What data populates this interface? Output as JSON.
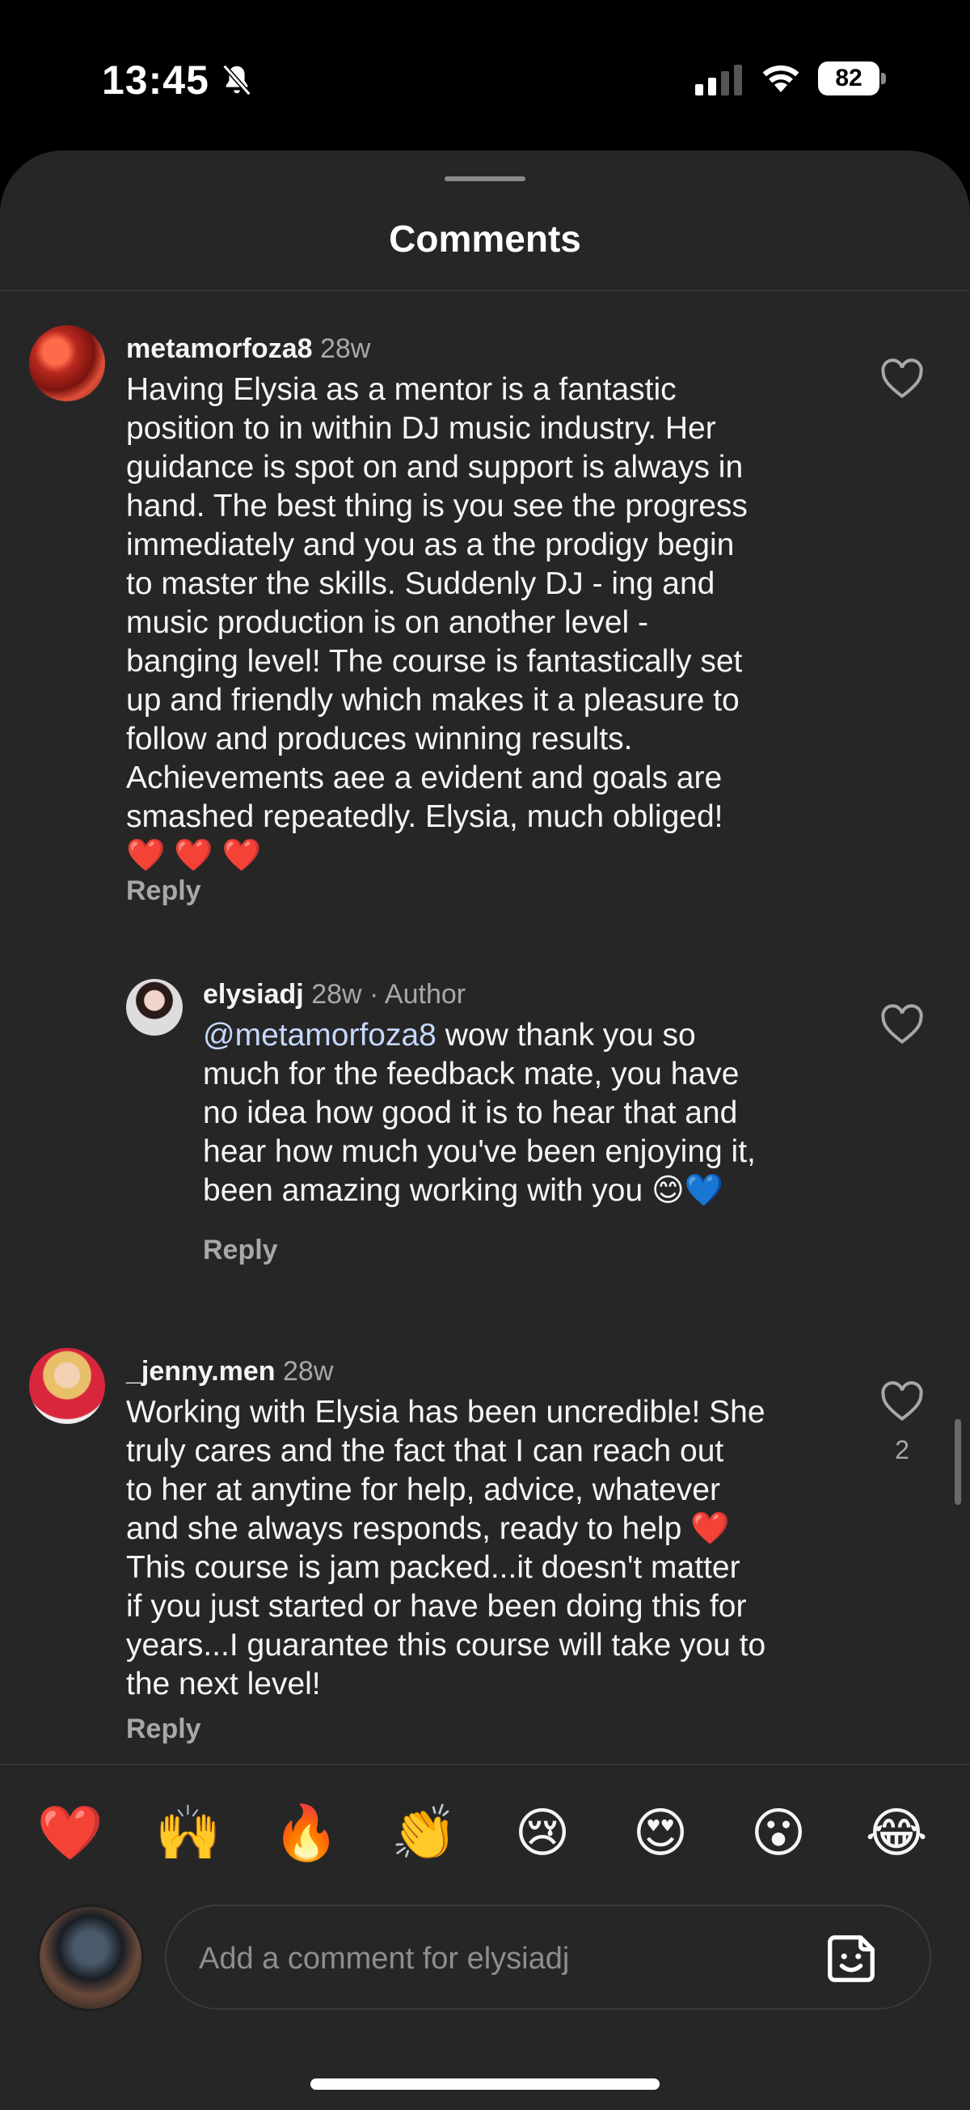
{
  "status_bar": {
    "time": "13:45",
    "battery": "82"
  },
  "sheet": {
    "title": "Comments"
  },
  "comments": [
    {
      "username": "metamorfoza8",
      "time": "28w",
      "lines": [
        "Having Elysia as a mentor is a fantastic",
        "position to in within DJ  music industry. Her",
        "guidance is spot on and support is always in",
        "hand. The best thing is you see the progress",
        "immediately and you as a the prodigy  begin",
        "to master the skills. Suddenly DJ - ing and",
        "music production is on another level -",
        "banging level!  The course is fantastically set",
        "up and friendly which makes it a pleasure to",
        "follow and produces winning results.",
        "Achievements aee a evident and goals are",
        "smashed repeatedly. Elysia, much obliged!",
        "❤️ ❤️ ❤️"
      ],
      "reply_label": "Reply"
    },
    {
      "username": "elysiadj",
      "time": "28w",
      "author_badge": "· Author",
      "mention": "@metamorfoza8",
      "line1_rest": " wow thank you so",
      "lines": [
        "much for the feedback mate, you have",
        "no idea how good it is to hear that and",
        "hear how much you've been enjoying it,",
        "been amazing working with you 😊💙"
      ],
      "reply_label": "Reply"
    },
    {
      "username": "_jenny.men",
      "time": "28w",
      "likes": "2",
      "lines": [
        "Working with Elysia has been uncredible! She",
        "truly cares and the fact that I can reach out",
        "to her at anytine for help, advice, whatever",
        "and she always responds, ready to help ❤️",
        "This course is jam packed...it doesn't matter",
        "if you just started or have been doing this for",
        "years...I guarantee this course will take you to",
        "the next level!"
      ],
      "reply_label": "Reply"
    }
  ],
  "reactions": [
    "❤️",
    "🙌",
    "🔥",
    "👏",
    "😢",
    "😍",
    "😮",
    "😂"
  ],
  "composer": {
    "placeholder": "Add a comment for elysiadj"
  },
  "icons": {
    "heart": "heart-outline-icon",
    "sticker": "sticker-icon",
    "bell": "bell-slash-icon",
    "signal": "cellular-signal-icon",
    "wifi": "wifi-icon"
  }
}
